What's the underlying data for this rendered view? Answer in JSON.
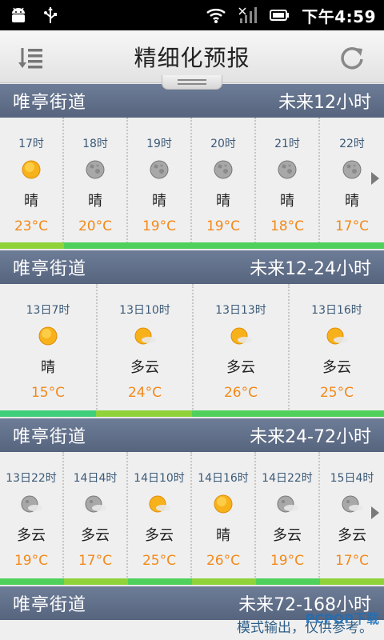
{
  "status": {
    "time": "下午4:59"
  },
  "title": "精细化预报",
  "sections": [
    {
      "location": "唯亭街道",
      "range": "未来12小时",
      "cells": [
        {
          "time": "17时",
          "icon": "sun-icon",
          "cond": "晴",
          "temp": "23°C"
        },
        {
          "time": "18时",
          "icon": "moon-icon",
          "cond": "晴",
          "temp": "20°C"
        },
        {
          "time": "19时",
          "icon": "moon-icon",
          "cond": "晴",
          "temp": "19°C"
        },
        {
          "time": "20时",
          "icon": "moon-icon",
          "cond": "晴",
          "temp": "19°C"
        },
        {
          "time": "21时",
          "icon": "moon-icon",
          "cond": "晴",
          "temp": "18°C"
        },
        {
          "time": "22时",
          "icon": "moon-icon",
          "cond": "晴",
          "temp": "17°C"
        }
      ],
      "bar_colors": [
        "#8fd23a",
        "#4fd05a",
        "#4fd05a",
        "#4fd05a",
        "#4fd05a",
        "#4fd05a"
      ]
    },
    {
      "location": "唯亭街道",
      "range": "未来12-24小时",
      "cells": [
        {
          "time": "13日7时",
          "icon": "sun-icon",
          "cond": "晴",
          "temp": "15°C"
        },
        {
          "time": "13日10时",
          "icon": "sun-cloud-icon",
          "cond": "多云",
          "temp": "24°C"
        },
        {
          "time": "13日13时",
          "icon": "sun-cloud-icon",
          "cond": "多云",
          "temp": "26°C"
        },
        {
          "time": "13日16时",
          "icon": "sun-cloud-icon",
          "cond": "多云",
          "temp": "25°C"
        }
      ],
      "bar_colors": [
        "#3fcf7a",
        "#8fd23a",
        "#4fd05a",
        "#4fd05a"
      ]
    },
    {
      "location": "唯亭街道",
      "range": "未来24-72小时",
      "cells": [
        {
          "time": "13日22时",
          "icon": "moon-cloud-icon",
          "cond": "多云",
          "temp": "19°C"
        },
        {
          "time": "14日4时",
          "icon": "moon-cloud-icon",
          "cond": "多云",
          "temp": "17°C"
        },
        {
          "time": "14日10时",
          "icon": "sun-cloud-icon",
          "cond": "多云",
          "temp": "25°C"
        },
        {
          "time": "14日16时",
          "icon": "sun-icon",
          "cond": "晴",
          "temp": "26°C"
        },
        {
          "time": "14日22时",
          "icon": "moon-cloud-icon",
          "cond": "多云",
          "temp": "19°C"
        },
        {
          "time": "15日4时",
          "icon": "moon-cloud-icon",
          "cond": "多云",
          "temp": "17°C"
        }
      ],
      "bar_colors": [
        "#4fd05a",
        "#8fd23a",
        "#4fd05a",
        "#8fd23a",
        "#4fd05a",
        "#8fd23a"
      ]
    },
    {
      "location": "唯亭街道",
      "range": "未来72-168小时"
    }
  ],
  "footer_note": "模式输出，仅供参考。",
  "watermark": "PCPOP下载"
}
